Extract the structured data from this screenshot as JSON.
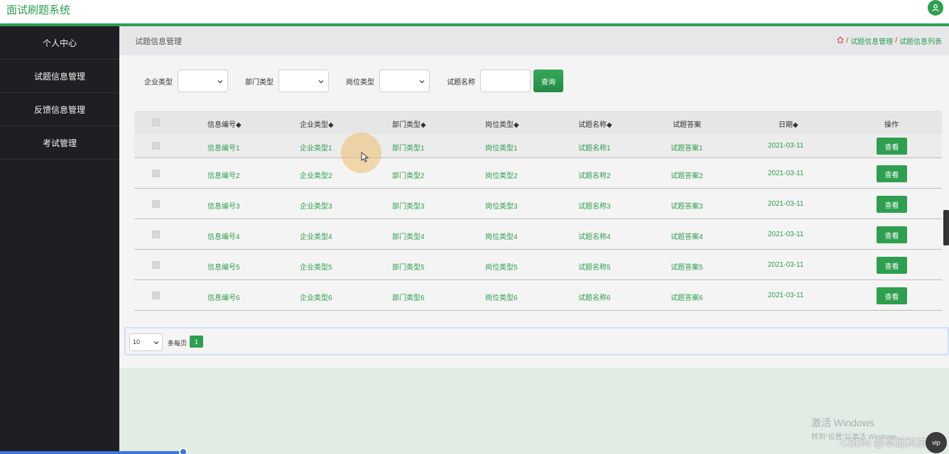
{
  "app": {
    "title": "面试刷题系统"
  },
  "sidebar": {
    "items": [
      {
        "label": "个人中心"
      },
      {
        "label": "试题信息管理"
      },
      {
        "label": "反馈信息管理"
      },
      {
        "label": "考试管理"
      }
    ]
  },
  "header": {
    "page_title": "试题信息管理",
    "breadcrumb": [
      "试题信息管理",
      "试题信息列表"
    ],
    "breadcrumb_sep": "/"
  },
  "filters": {
    "company_type_label": "企业类型",
    "department_type_label": "部门类型",
    "position_type_label": "岗位类型",
    "question_name_label": "试题名称",
    "question_name_value": "",
    "query_button": "查询"
  },
  "table": {
    "headers": [
      "信息编号◆",
      "企业类型◆",
      "部门类型◆",
      "岗位类型◆",
      "试题名称◆",
      "试题答案",
      "日期◆",
      "操作"
    ],
    "rows": [
      {
        "id": "信息编号1",
        "company": "企业类型1",
        "department": "部门类型1",
        "position": "岗位类型1",
        "name": "试题名称1",
        "answer": "试题答案1",
        "date": "2021-03-11",
        "action": "查看"
      },
      {
        "id": "信息编号2",
        "company": "企业类型2",
        "department": "部门类型2",
        "position": "岗位类型2",
        "name": "试题名称2",
        "answer": "试题答案2",
        "date": "2021-03-11",
        "action": "查看"
      },
      {
        "id": "信息编号3",
        "company": "企业类型3",
        "department": "部门类型3",
        "position": "岗位类型3",
        "name": "试题名称3",
        "answer": "试题答案3",
        "date": "2021-03-11",
        "action": "查看"
      },
      {
        "id": "信息编号4",
        "company": "企业类型4",
        "department": "部门类型4",
        "position": "岗位类型4",
        "name": "试题名称4",
        "answer": "试题答案4",
        "date": "2021-03-11",
        "action": "查看"
      },
      {
        "id": "信息编号5",
        "company": "企业类型5",
        "department": "部门类型5",
        "position": "岗位类型5",
        "name": "试题名称5",
        "answer": "试题答案5",
        "date": "2021-03-11",
        "action": "查看"
      },
      {
        "id": "信息编号6",
        "company": "企业类型6",
        "department": "部门类型6",
        "position": "岗位类型6",
        "name": "试题名称6",
        "answer": "试题答案6",
        "date": "2021-03-11",
        "action": "查看"
      }
    ]
  },
  "pagination": {
    "page_size": "10",
    "per_page_label": "条每页",
    "current_page": "1"
  },
  "overlay": {
    "watermark_line1": "激活 Windows",
    "watermark_line2": "转到\"设置\"以激活 Windows。",
    "csdn": "CSDN @卓远科技",
    "badge": "vip"
  },
  "colors": {
    "accent": "#2e9e4f",
    "sidebar_bg": "#1f1f23"
  }
}
